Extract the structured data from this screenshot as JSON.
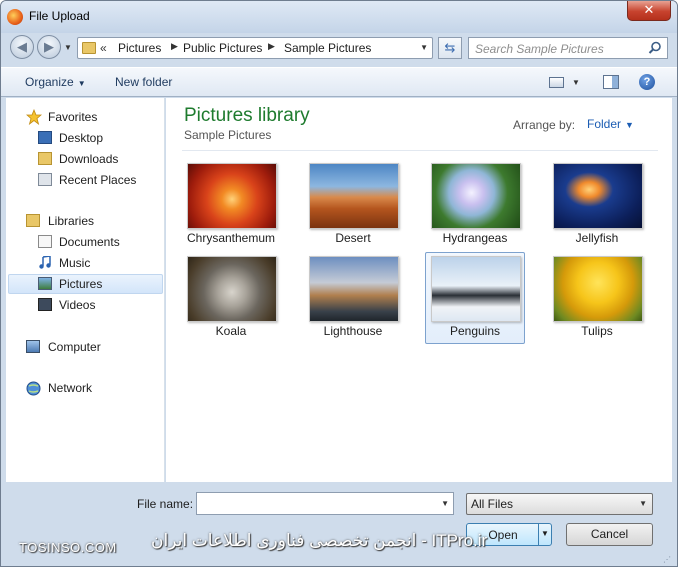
{
  "window": {
    "title": "File Upload",
    "close_glyph": "✕"
  },
  "nav": {
    "back_glyph": "◀",
    "forward_glyph": "▶",
    "overflow": "«",
    "breadcrumbs": [
      "Pictures",
      "Public Pictures",
      "Sample Pictures"
    ],
    "crumb_sep": "▶",
    "search_placeholder": "Search Sample Pictures"
  },
  "toolbar": {
    "organize": "Organize",
    "new_folder": "New folder",
    "help": "?"
  },
  "sidebar": {
    "favorites": {
      "label": "Favorites",
      "items": [
        "Desktop",
        "Downloads",
        "Recent Places"
      ]
    },
    "libraries": {
      "label": "Libraries",
      "items": [
        "Documents",
        "Music",
        "Pictures",
        "Videos"
      ]
    },
    "computer": "Computer",
    "network": "Network",
    "selected": "Pictures"
  },
  "content": {
    "title": "Pictures library",
    "subtitle": "Sample Pictures",
    "arrange_label": "Arrange by:",
    "arrange_value": "Folder",
    "files": [
      "Chrysanthemum",
      "Desert",
      "Hydrangeas",
      "Jellyfish",
      "Koala",
      "Lighthouse",
      "Penguins",
      "Tulips"
    ],
    "selected": "Penguins"
  },
  "bottom": {
    "file_name_label": "File name:",
    "file_name_value": "",
    "filter_value": "All Files",
    "open_label": "Open",
    "cancel_label": "Cancel"
  },
  "watermark": {
    "left": "TOSINSO.COM",
    "right": "ITPro.ir - انجمن تخصصی فناوری اطلاعات ایران"
  },
  "colors": {
    "library_title": "#1e7b2e",
    "link": "#1c5db3",
    "selection": "#d3e5fa"
  }
}
